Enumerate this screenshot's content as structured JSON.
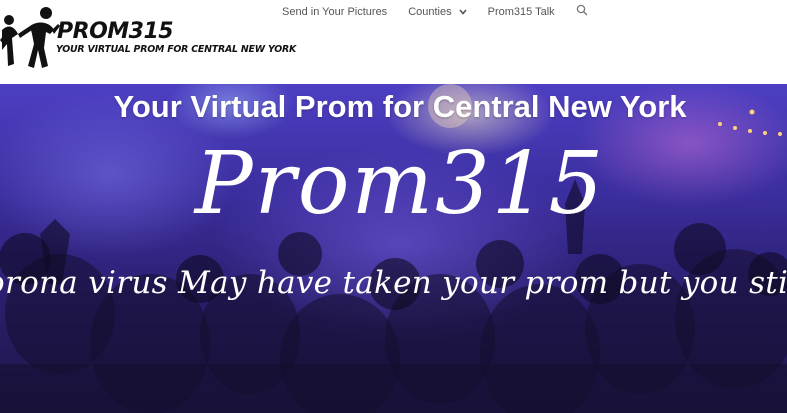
{
  "logo": {
    "title": "PROM315",
    "tagline": "YOUR VIRTUAL PROM FOR CENTRAL NEW YORK"
  },
  "nav": {
    "items": [
      {
        "label": "Send in Your Pictures"
      },
      {
        "label": "Counties",
        "has_dropdown": true
      },
      {
        "label": "Prom315 Talk"
      }
    ],
    "search_icon": "search-icon",
    "dropdown_icon": "chevron-down-icon"
  },
  "hero": {
    "heading": "Your Virtual Prom for Central New York",
    "brand": "Prom315",
    "tagline": "orona virus May have taken your prom but you still can"
  },
  "colors": {
    "nav_text": "#555555",
    "hero_text": "#ffffff",
    "hero_background": "#3a2d9c"
  }
}
